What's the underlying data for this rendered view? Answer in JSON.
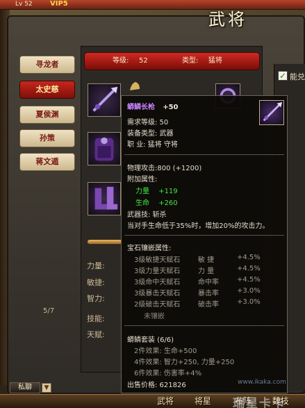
{
  "top": {
    "level_text": "Lv 52",
    "vip_text": "VIP5"
  },
  "window": {
    "title": "武将"
  },
  "tabs": [
    {
      "label": "寻龙者",
      "active": false
    },
    {
      "label": "太史慈",
      "active": true
    },
    {
      "label": "夏侯渊",
      "active": false
    },
    {
      "label": "孙策",
      "active": false
    },
    {
      "label": "蒋文遁",
      "active": false
    }
  ],
  "header": {
    "level_label": "等级:",
    "level_value": "52",
    "type_label": "类型:",
    "type_value": "猛将"
  },
  "stats": {
    "str": "力量:",
    "agi": "敏捷:",
    "int": "智力:",
    "skill": "技能:",
    "talent": "天赋:"
  },
  "pager": "5/7",
  "right": {
    "checkbox_label": "能兑"
  },
  "tooltip": {
    "item_name": "蟒鳞长枪",
    "item_plus": "+50",
    "req_level": "需求等级:  50",
    "equip_type": "装备类型:  武器",
    "job": "职      业:  猛将  守将",
    "phys_atk": "物理攻击:800  (+1200)",
    "extra_title": "附加属性:",
    "extra": [
      {
        "name": "力量",
        "value": "+119"
      },
      {
        "name": "生命",
        "value": "+260"
      }
    ],
    "weapon_skill": "武器技:  斩杀",
    "skill_desc": "当对手生命低于35%时，增加20%的攻击力。",
    "gem_title": "宝石镶嵌属性:",
    "gems": [
      {
        "gem": "3级敏捷天赋石",
        "attr": "敏    捷",
        "value": "+4.5%"
      },
      {
        "gem": "3级力量天赋石",
        "attr": "力    量",
        "value": "+4.5%"
      },
      {
        "gem": "3级命中天赋石",
        "attr": "命中率",
        "value": "+4.5%"
      },
      {
        "gem": "3级暴击天赋石",
        "attr": "暴击率",
        "value": "+3.0%"
      },
      {
        "gem": "2级破击天赋石",
        "attr": "破击率",
        "value": "+3.0%"
      }
    ],
    "gem_empty": "未镶嵌",
    "set_title": "蟒鳞套装 (6/6)",
    "set_effects": [
      "2件效果:  生命+500",
      "4件效果:  智力+250, 力量+250",
      "6件效果:  伤害率+4%"
    ],
    "sell_price": "出售价格:  621826"
  },
  "bottom": {
    "chat": "私聊",
    "chat_arrow": "▼",
    "buttons": [
      "武将",
      "将星",
      "布阵",
      "魏技"
    ],
    "watermark": "瑞星卡卡",
    "watermark_url": "www.ikaka.com"
  },
  "colors": {
    "tab_active": "#b81c14",
    "header_red": "#c22820",
    "item_purple": "#c884ff",
    "bonus_green": "#40e840"
  }
}
